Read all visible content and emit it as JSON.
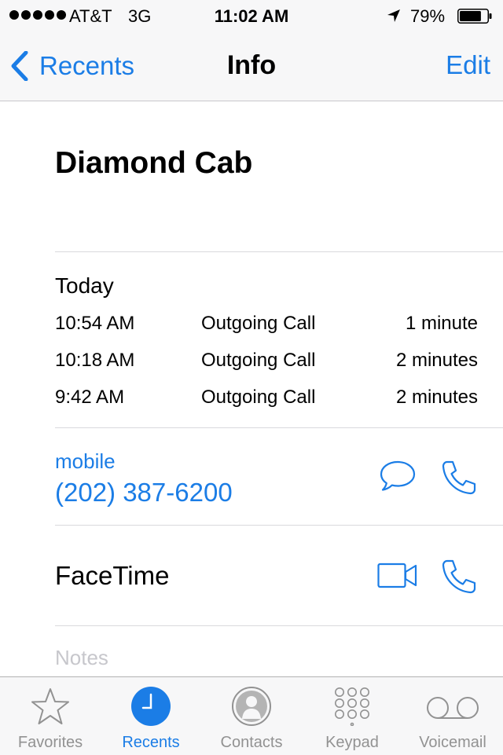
{
  "status_bar": {
    "carrier": "AT&T",
    "network": "3G",
    "time": "11:02 AM",
    "battery": "79%",
    "battery_level": 0.79
  },
  "nav": {
    "back_label": "Recents",
    "title": "Info",
    "edit_label": "Edit"
  },
  "contact": {
    "name": "Diamond Cab"
  },
  "calls": {
    "section_label": "Today",
    "rows": [
      {
        "time": "10:54 AM",
        "kind": "Outgoing Call",
        "duration": "1 minute"
      },
      {
        "time": "10:18 AM",
        "kind": "Outgoing Call",
        "duration": "2 minutes"
      },
      {
        "time": "9:42 AM",
        "kind": "Outgoing Call",
        "duration": "2 minutes"
      }
    ]
  },
  "phone": {
    "label": "mobile",
    "number": "(202) 387-6200",
    "message_icon": "message-bubble-icon",
    "call_icon": "phone-handset-icon"
  },
  "facetime": {
    "label": "FaceTime",
    "video_icon": "video-camera-icon",
    "audio_icon": "phone-handset-icon"
  },
  "notes": {
    "placeholder": "Notes"
  },
  "tabs": [
    {
      "label": "Favorites",
      "icon": "star-icon",
      "active": false
    },
    {
      "label": "Recents",
      "icon": "clock-icon",
      "active": true
    },
    {
      "label": "Contacts",
      "icon": "person-icon",
      "active": false
    },
    {
      "label": "Keypad",
      "icon": "keypad-icon",
      "active": false
    },
    {
      "label": "Voicemail",
      "icon": "voicemail-icon",
      "active": false
    }
  ],
  "colors": {
    "accent": "#1b7de6",
    "inactive_tab": "#929292",
    "separator": "#d9d9dd",
    "bar_background": "#f7f7f8"
  }
}
